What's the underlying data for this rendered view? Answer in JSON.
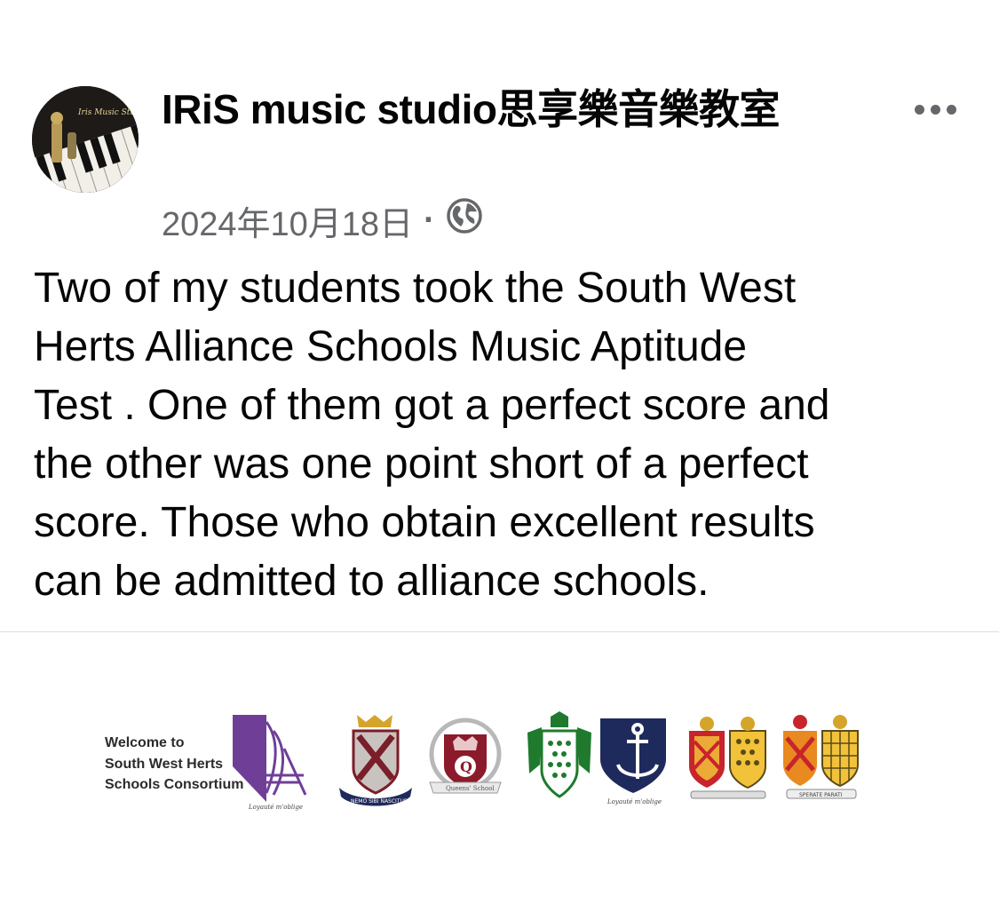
{
  "post": {
    "author_name": "IRiS  music studio思享樂音樂教室",
    "timestamp": "2024年10月18日",
    "separator": "·",
    "audience_icon": "globe-icon",
    "more_icon": "more-horizontal-icon",
    "body": "Two of my students took the South West\nHerts Alliance Schools Music Aptitude\nTest . One of them got a perfect score and\nthe other was one point short of a perfect\nscore. Those who obtain excellent results\ncan be admitted to alliance schools."
  },
  "avatar": {
    "script_text": "Iris Music Studio"
  },
  "image": {
    "welcome_text": "Welcome to\nSouth West Herts\nSchools Consortium",
    "crests": [
      {
        "name": "consortium-logo",
        "motto": "Loyauté m'oblige"
      },
      {
        "name": "school-crest-cross",
        "motto": "NEMO SIBI NASCITUR"
      },
      {
        "name": "school-crest-queens",
        "motto": "Queens' School"
      },
      {
        "name": "school-crest-green",
        "motto": ""
      },
      {
        "name": "school-crest-anchor",
        "motto": "Loyauté m'oblige"
      },
      {
        "name": "school-crest-double-shield",
        "motto": ""
      },
      {
        "name": "school-crest-double-shield-2",
        "motto": "SPERATE PARATI"
      }
    ]
  },
  "colors": {
    "text_primary": "#050505",
    "text_secondary": "#65676b",
    "divider": "#dadde1",
    "purple": "#6f3f98",
    "navy": "#1f2a5c",
    "maroon": "#8b1a2a",
    "green": "#1f7a2e",
    "gold": "#d4a52a",
    "red": "#c8242b"
  }
}
